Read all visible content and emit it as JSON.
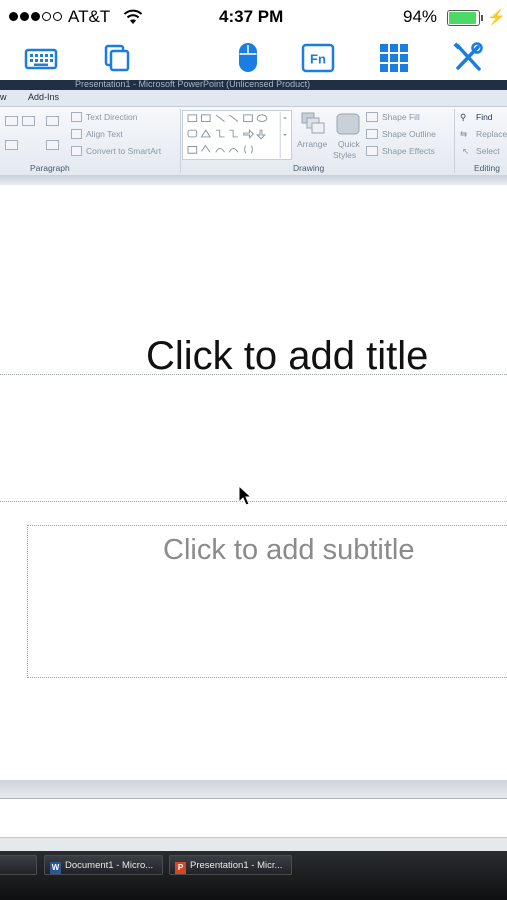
{
  "status_bar": {
    "carrier": "AT&T",
    "time": "4:37 PM",
    "battery_percent": "94%",
    "battery_level": 0.94
  },
  "toolbar": {
    "icons": [
      "keyboard-icon",
      "copy-icon",
      "mouse-icon",
      "fn-key-icon",
      "apps-grid-icon",
      "tools-icon"
    ],
    "fn_label": "Fn"
  },
  "office": {
    "window_title": "Presentation1 - Microsoft PowerPoint (Unlicensed Product)",
    "tabs": [
      "w",
      "Add-Ins"
    ],
    "paragraph_group": {
      "items": [
        "Text Direction",
        "Align Text",
        "Convert to SmartArt"
      ],
      "label": "Paragraph"
    },
    "drawing_group": {
      "arrange": "Arrange",
      "quick_styles_line1": "Quick",
      "quick_styles_line2": "Styles",
      "shape_fill": "Shape Fill",
      "shape_outline": "Shape Outline",
      "shape_effects": "Shape Effects",
      "label": "Drawing"
    },
    "editing_group": {
      "find": "Find",
      "replace": "Replace",
      "select": "Select",
      "label": "Editing"
    },
    "slide": {
      "title_placeholder": "Click to add title",
      "subtitle_placeholder": "Click to add subtitle"
    },
    "taskbar": {
      "items": [
        {
          "icon": "word-icon",
          "label": "Document1 - Micro..."
        },
        {
          "icon": "powerpoint-icon",
          "label": "Presentation1 - Micr..."
        }
      ]
    }
  },
  "colors": {
    "ios_blue": "#1a7de0",
    "battery_green": "#4cd964",
    "word_blue": "#2b5797",
    "powerpoint_orange": "#d24726"
  }
}
